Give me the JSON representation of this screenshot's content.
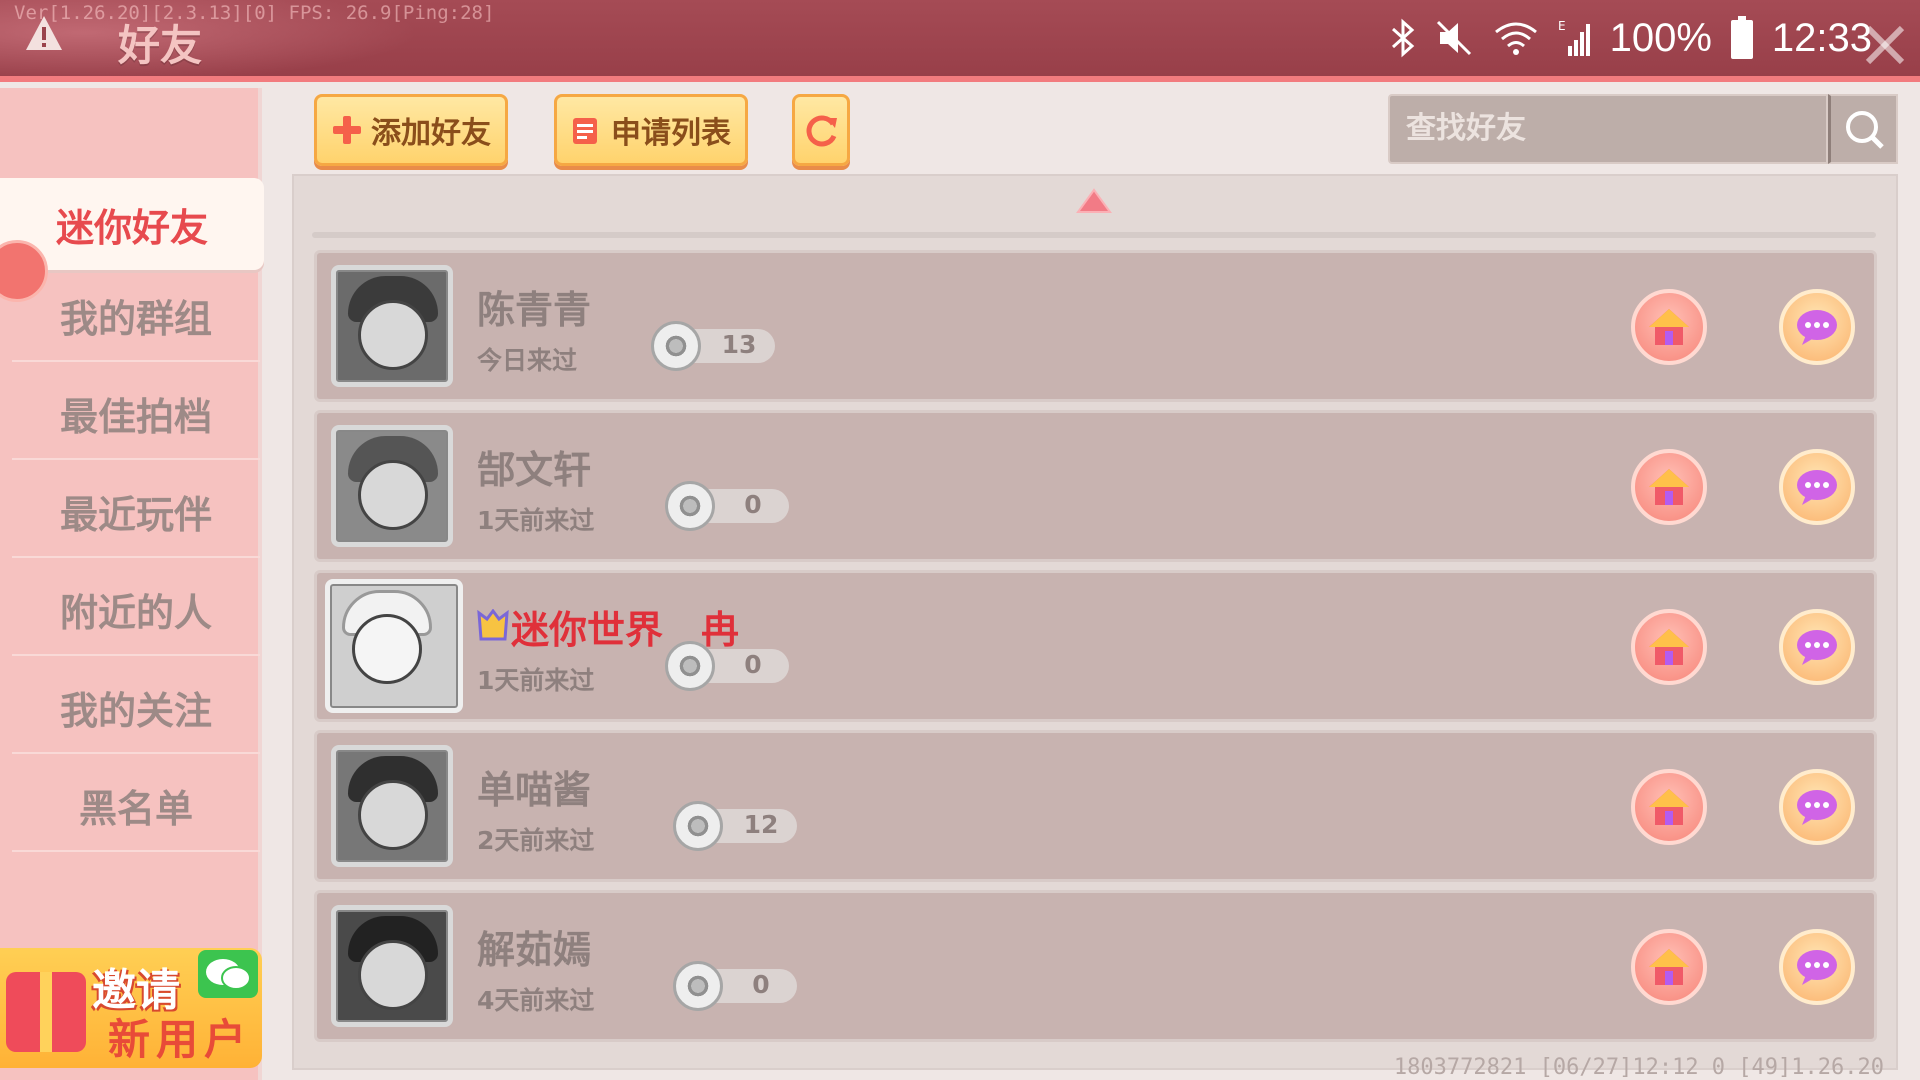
{
  "topbar": {
    "debug_text": "Ver[1.26.20][2.3.13][0] FPS: 26.9[Ping:28]",
    "title": "好友",
    "battery_pct": "100%",
    "time": "12:33"
  },
  "sidebar": {
    "items": [
      {
        "label": "迷你好友",
        "active": true
      },
      {
        "label": "我的群组",
        "active": false
      },
      {
        "label": "最佳拍档",
        "active": false
      },
      {
        "label": "最近玩伴",
        "active": false
      },
      {
        "label": "附近的人",
        "active": false
      },
      {
        "label": "我的关注",
        "active": false
      },
      {
        "label": "黑名单",
        "active": false
      }
    ],
    "invite": {
      "line1": "邀请",
      "line2": "新用户"
    }
  },
  "toolbar": {
    "add_friend_label": "添加好友",
    "request_list_label": "申请列表",
    "search_placeholder": "查找好友"
  },
  "friends": [
    {
      "name": "陈青青",
      "last_visit": "今日来过",
      "flowers": "13"
    },
    {
      "name": "郜文轩",
      "last_visit": "1天前来过",
      "flowers": "0"
    },
    {
      "name": "迷你世界　冉",
      "last_visit": "1天前来过",
      "flowers": "0",
      "special": true
    },
    {
      "name": "单喵酱",
      "last_visit": "2天前来过",
      "flowers": "12"
    },
    {
      "name": "解茹嫣",
      "last_visit": "4天前来过",
      "flowers": "0"
    }
  ],
  "footer": "1803772821   [06/27]12:12 0  [49]1.26.20",
  "colors": {
    "topbar": "#a54b55",
    "sidebar": "#f6c2c0",
    "active_text": "#e74a4e",
    "special_name": "#e0303a",
    "button_fill": "#ffd36d"
  },
  "icons": [
    "warning-icon",
    "bluetooth-icon",
    "mute-icon",
    "wifi-icon",
    "signal-icon",
    "battery-icon",
    "close-icon",
    "plus-icon",
    "list-icon",
    "refresh-icon",
    "search-icon",
    "home-icon",
    "chat-icon",
    "flower-icon",
    "wechat-icon",
    "gift-icon"
  ]
}
